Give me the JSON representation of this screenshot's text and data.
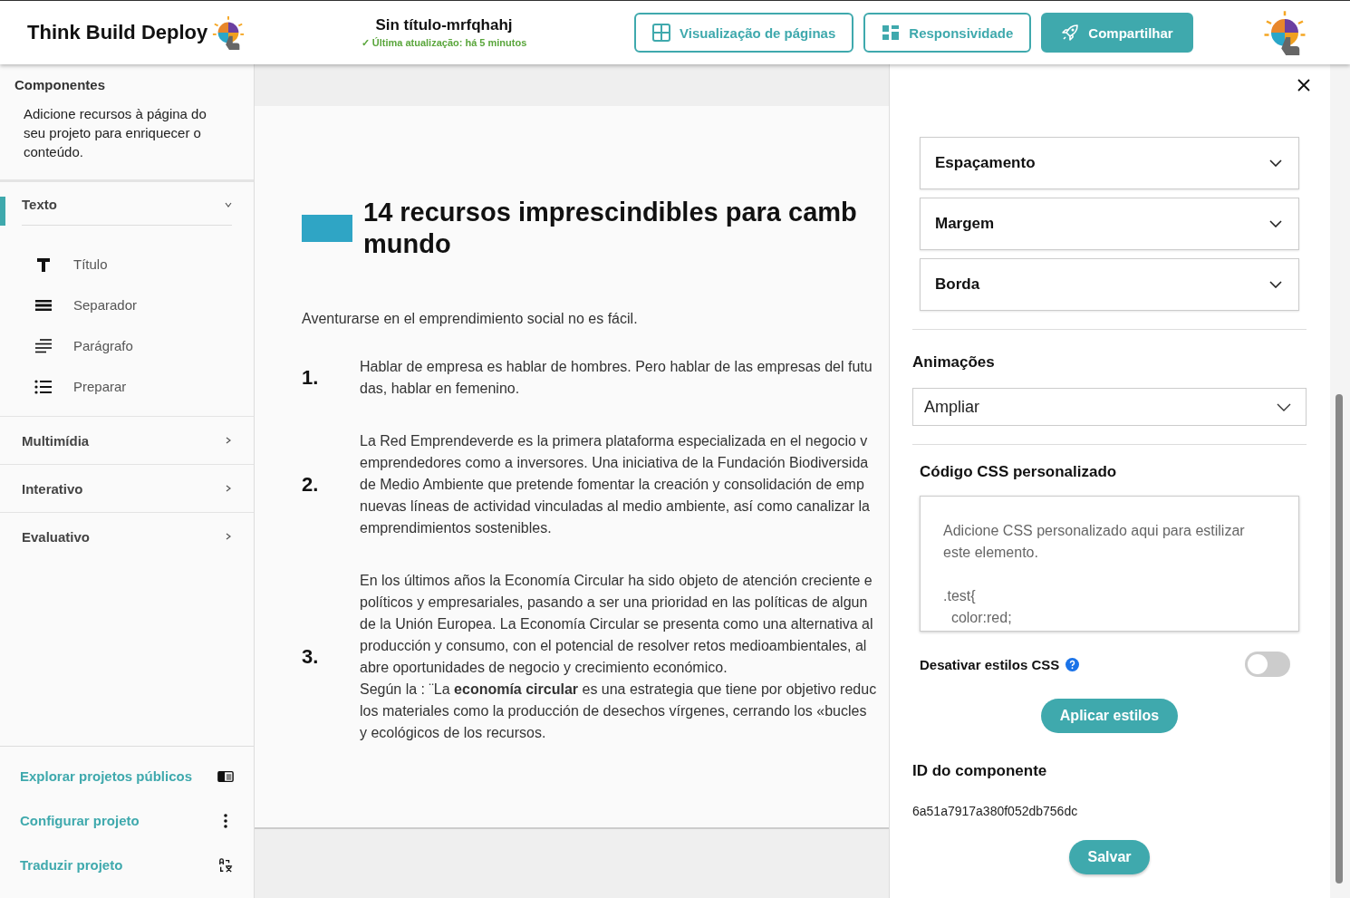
{
  "header": {
    "brand": "Think Build Deploy",
    "project_title": "Sin título-mrfqhahj",
    "last_update": "✓ Última atualização: há 5 minutos",
    "buttons": [
      {
        "label": "Visualização de páginas",
        "kind": "outline"
      },
      {
        "label": "Responsividade",
        "kind": "outline"
      },
      {
        "label": "Compartilhar",
        "kind": "filled"
      }
    ]
  },
  "sidebar": {
    "title": "Componentes",
    "description": "Adicione recursos à página do seu projeto para enriquecer o conteúdo.",
    "categories": [
      {
        "label": "Texto",
        "expanded": true,
        "selected": true,
        "items": [
          {
            "label": "Título",
            "kind": "title"
          },
          {
            "label": "Separador",
            "kind": "separator"
          },
          {
            "label": "Parágrafo",
            "kind": "paragraph"
          },
          {
            "label": "Preparar",
            "kind": "list"
          }
        ]
      },
      {
        "label": "Multimídia",
        "expanded": false,
        "selected": false
      },
      {
        "label": "Interativo",
        "expanded": false,
        "selected": false
      },
      {
        "label": "Evaluativo",
        "expanded": false,
        "selected": false
      }
    ],
    "footer_links": [
      {
        "label": "Explorar projetos públicos",
        "kind": "explore"
      },
      {
        "label": "Configurar projeto",
        "kind": "settings"
      },
      {
        "label": "Traduzir projeto",
        "kind": "translate"
      }
    ]
  },
  "canvas": {
    "heading_lines": [
      "14 recursos imprescindibles para camb",
      "mundo"
    ],
    "intro": "Aventurarse en el emprendimiento social no es fácil.",
    "items": [
      {
        "number": "1.",
        "lines": [
          "Hablar de empresa es hablar de hombres. Pero hablar de las empresas del futu",
          "das, hablar en femenino."
        ]
      },
      {
        "number": "2.",
        "lines": [
          "La Red Emprendeverde es la primera plataforma especializada en el negocio v",
          "emprendedores como a inversores. Una iniciativa de la Fundación Biodiversida",
          "de Medio Ambiente que pretende fomentar la creación y consolidación de emp",
          "nuevas líneas de actividad vinculadas al medio ambiente, así como canalizar la",
          "emprendimientos sostenibles."
        ]
      },
      {
        "number": "3.",
        "lines": [
          "En los últimos años la Economía Circular ha sido objeto de atención creciente e",
          "políticos y empresariales, pasando a ser una prioridad en las políticas de algun",
          "de la Unión Europea. La Economía Circular se presenta como una alternativa al",
          "producción y consumo, con el potencial de resolver retos medioambientales, al",
          "abre oportunidades de negocio y crecimiento económico.",
          "Según la : ¨La **economía circular** es una estrategia que tiene por objetivo reduc",
          "los materiales como la producción de desechos vírgenes, cerrando los «bucles",
          "y ecológicos de los recursos."
        ]
      }
    ]
  },
  "panel": {
    "accordions": [
      {
        "label": "Espaçamento",
        "expanded": false
      },
      {
        "label": "Margem",
        "expanded": false
      },
      {
        "label": "Borda",
        "expanded": false
      }
    ],
    "animations_label": "Animações",
    "animation_value": "Ampliar",
    "css_label": "Código CSS personalizado",
    "css_placeholder": "Adicione CSS personalizado aqui para estilizar este elemento.\n\n.test{\n  color:red;",
    "disable_label": "Desativar estilos CSS",
    "disable_on": false,
    "apply_button": "Aplicar estilos",
    "id_label": "ID do componente",
    "id_value": "6a51a7917a380f052db756dc",
    "save_button": "Salvar"
  }
}
